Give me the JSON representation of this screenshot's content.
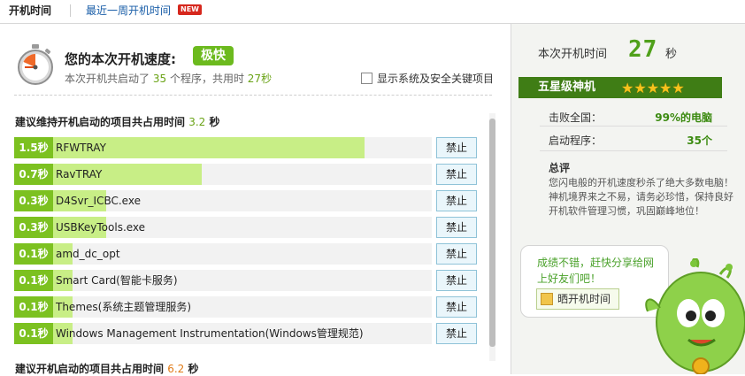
{
  "tabs": [
    {
      "label": "开机时间",
      "active": true
    },
    {
      "label": "最近一周开机时间",
      "active": false,
      "badge": "NEW"
    }
  ],
  "speed": {
    "title": "您的本次开机速度:",
    "badge": "极快",
    "summary_prefix": "本次开机共启动了",
    "program_count": "35",
    "summary_mid": "个程序，共用时",
    "total_time": "27秒",
    "show_system_label": "显示系统及安全关键项目"
  },
  "keep_section": {
    "title": "建议维持开机启动的项目共占用时间",
    "value": "3.2",
    "unit": "秒"
  },
  "disable_section": {
    "title": "建议开机启动的项目共占用时间",
    "value": "6.2",
    "unit": "秒"
  },
  "startup_items": [
    {
      "time": "1.5秒",
      "name": "RFWTRAY",
      "fill": 0.84,
      "action": "禁止"
    },
    {
      "time": "0.7秒",
      "name": "RavTRAY",
      "fill": 0.45,
      "action": "禁止"
    },
    {
      "time": "0.3秒",
      "name": "D4Svr_ICBC.exe",
      "fill": 0.22,
      "action": "禁止"
    },
    {
      "time": "0.3秒",
      "name": "USBKeyTools.exe",
      "fill": 0.22,
      "action": "禁止"
    },
    {
      "time": "0.1秒",
      "name": "amd_dc_opt",
      "fill": 0.14,
      "action": "禁止"
    },
    {
      "time": "0.1秒",
      "name": "Smart Card(智能卡服务)",
      "fill": 0.14,
      "action": "禁止"
    },
    {
      "time": "0.1秒",
      "name": "Themes(系统主题管理服务)",
      "fill": 0.14,
      "action": "禁止"
    },
    {
      "time": "0.1秒",
      "name": "Windows Management Instrumentation(Windows管理规范)",
      "fill": 0.14,
      "action": "禁止"
    }
  ],
  "side": {
    "boot_label": "本次开机时间",
    "boot_value": "27",
    "boot_unit": "秒",
    "rank_label": "五星级神机",
    "stars": "★★★★★",
    "beat_label": "击败全国：",
    "beat_value": "99%的电脑",
    "startup_label": "启动程序：",
    "startup_value": "35个",
    "review_title": "总评",
    "review_text": "您闪电般的开机速度秒杀了绝大多数电脑！神机境界来之不易，请务必珍惜，保持良好开机软件管理习惯，巩固巅峰地位！",
    "share_prompt": "成绩不错，赶快分享给网上好友们吧！",
    "share_button": "晒开机时间"
  },
  "colors": {
    "accent_green": "#7cc120",
    "bar_green": "#c8ee86",
    "rank_band": "#3f7d15",
    "new_badge": "#d6271d"
  }
}
